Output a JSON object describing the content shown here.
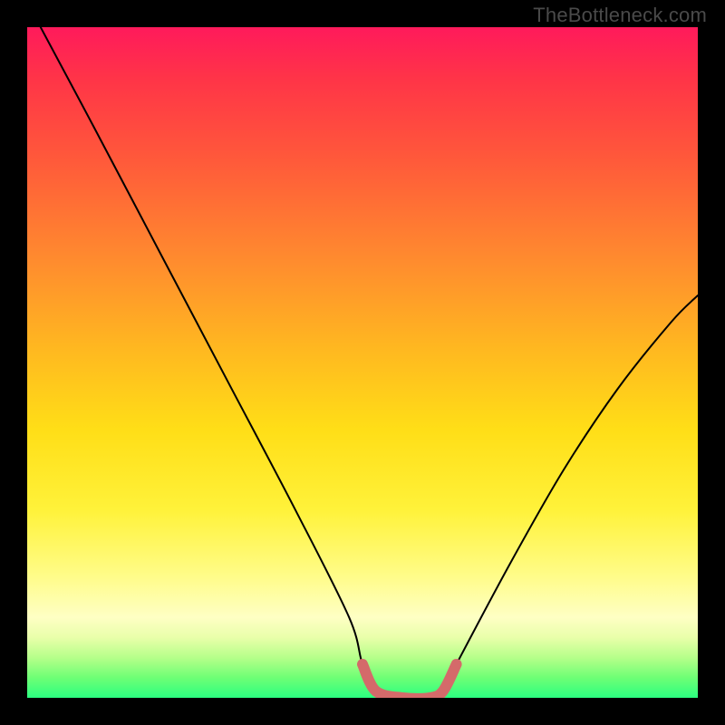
{
  "watermark": "TheBottleneck.com",
  "chart_data": {
    "type": "line",
    "title": "",
    "xlabel": "",
    "ylabel": "",
    "xlim": [
      0,
      100
    ],
    "ylim": [
      0,
      100
    ],
    "series": [
      {
        "name": "curve",
        "x": [
          2,
          10,
          20,
          30,
          40,
          48,
          50,
          52,
          56,
          60,
          62,
          64,
          72,
          80,
          88,
          96,
          100
        ],
        "y": [
          100,
          85,
          66,
          47,
          28,
          12,
          5,
          1,
          0,
          0,
          1,
          5,
          20,
          34,
          46,
          56,
          60
        ]
      }
    ],
    "annotations": [
      {
        "name": "flat-bottom-highlight",
        "x_start": 50,
        "x_end": 64,
        "color": "#d46a6a"
      }
    ],
    "background_gradient": {
      "orientation": "vertical",
      "stops": [
        {
          "pos": 0.0,
          "color": "#ff1a5b"
        },
        {
          "pos": 0.35,
          "color": "#ff8c2e"
        },
        {
          "pos": 0.6,
          "color": "#ffde17"
        },
        {
          "pos": 0.88,
          "color": "#feffc4"
        },
        {
          "pos": 1.0,
          "color": "#2bff80"
        }
      ]
    }
  }
}
